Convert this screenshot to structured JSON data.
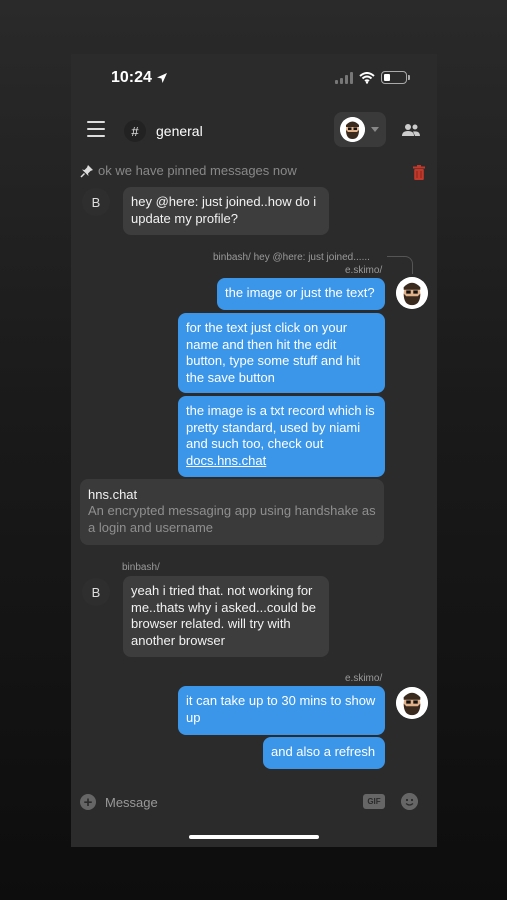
{
  "status_bar": {
    "time": "10:24"
  },
  "header": {
    "channel_hash": "#",
    "channel_name": "general"
  },
  "pinned": {
    "text": "ok we have pinned messages now"
  },
  "messages": [
    {
      "author_initial": "B",
      "text": "hey @here: just joined..how do i update my profile?"
    },
    {
      "reply_preview": "binbash/  hey @here: just joined......",
      "author": "e.skimo/"
    },
    {
      "text": "the image or just the text?"
    },
    {
      "text": "for the text just click on your name and then hit the edit button, type some stuff and hit the save button"
    },
    {
      "text_before_link": "the image is a txt record which is pretty standard, used by niami and such too, check out ",
      "link": "docs.hns.chat"
    },
    {
      "author": "binbash/",
      "author_initial": "B",
      "text": "yeah i tried that. not working for me..thats why i asked...could be browser related. will try with another browser"
    },
    {
      "author": "e.skimo/"
    },
    {
      "text": "it can take up to 30 mins to show up"
    },
    {
      "text": "and also a refresh"
    }
  ],
  "link_preview": {
    "title": "hns.chat",
    "description": "An encrypted messaging app using handshake as a login and username"
  },
  "composer": {
    "placeholder": "Message",
    "gif_label": "GIF"
  },
  "colors": {
    "outgoing_bubble": "#3b96e9",
    "incoming_bubble": "#3d3d3d",
    "background": "#2b2b2b",
    "trash": "#c0392b"
  },
  "icons": [
    "location-arrow-icon",
    "signal-icon",
    "wifi-icon",
    "battery-icon",
    "menu-icon",
    "users-icon",
    "pin-icon",
    "trash-icon",
    "plus-icon",
    "gif-icon",
    "emoji-icon"
  ]
}
